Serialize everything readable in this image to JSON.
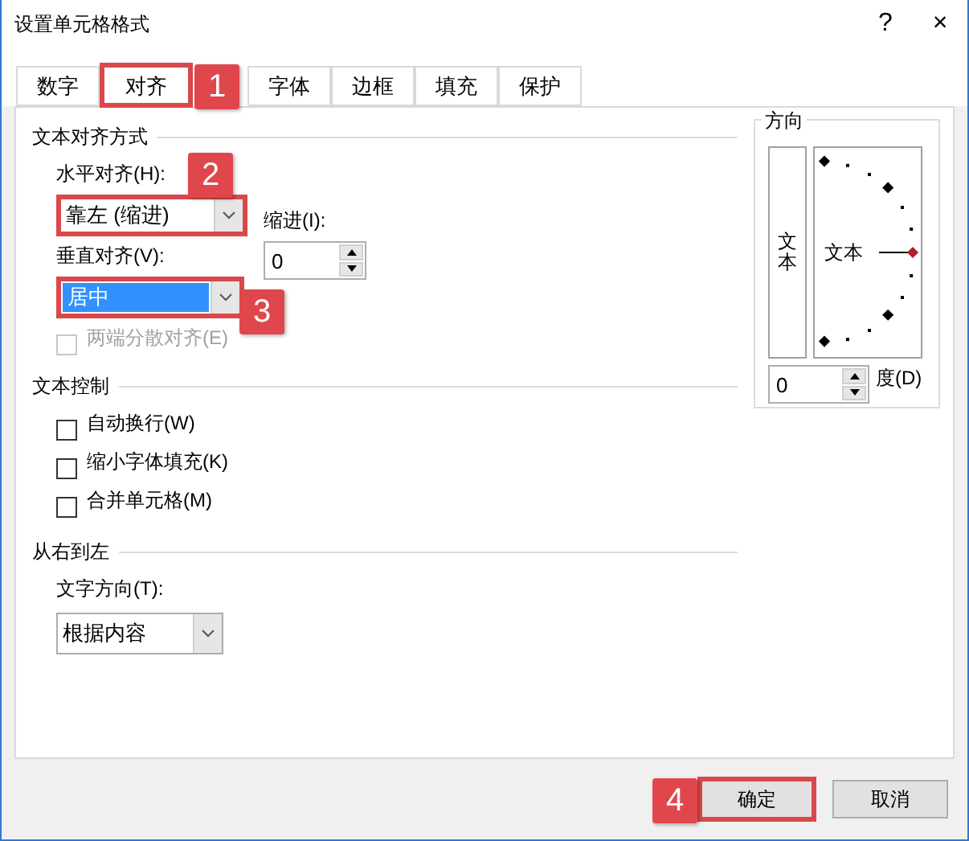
{
  "window": {
    "title": "设置单元格格式",
    "help": "?",
    "close": "×"
  },
  "tabs": [
    {
      "label": "数字",
      "selected": false,
      "highlighted": false
    },
    {
      "label": "对齐",
      "selected": true,
      "highlighted": true
    },
    {
      "label": "字体",
      "selected": false,
      "highlighted": false
    },
    {
      "label": "边框",
      "selected": false,
      "highlighted": false
    },
    {
      "label": "填充",
      "selected": false,
      "highlighted": false
    },
    {
      "label": "保护",
      "selected": false,
      "highlighted": false
    }
  ],
  "alignment": {
    "title": "文本对齐方式",
    "horizontal": {
      "label": "水平对齐(H):",
      "value": "靠左 (缩进)",
      "highlighted": true
    },
    "indent": {
      "label": "缩进(I):",
      "value": "0"
    },
    "vertical": {
      "label": "垂直对齐(V):",
      "value": "居中",
      "highlighted": true,
      "focused": true
    },
    "distributed": {
      "label": "两端分散对齐(E)",
      "checked": false,
      "disabled": true
    }
  },
  "text_control": {
    "title": "文本控制",
    "options": [
      {
        "label": "自动换行(W)",
        "checked": false
      },
      {
        "label": "缩小字体填充(K)",
        "checked": false
      },
      {
        "label": "合并单元格(M)",
        "checked": false
      }
    ]
  },
  "right_to_left": {
    "title": "从右到左",
    "direction": {
      "label": "文字方向(T):",
      "value": "根据内容"
    }
  },
  "orientation": {
    "title": "方向",
    "vertical_text": "文本",
    "dial_text": "文本",
    "degrees": {
      "value": "0",
      "label": "度(D)"
    }
  },
  "buttons": [
    {
      "label": "确定",
      "highlighted": true
    },
    {
      "label": "取消",
      "highlighted": false
    }
  ],
  "callouts": [
    {
      "number": "1"
    },
    {
      "number": "2"
    },
    {
      "number": "3"
    },
    {
      "number": "4"
    }
  ]
}
